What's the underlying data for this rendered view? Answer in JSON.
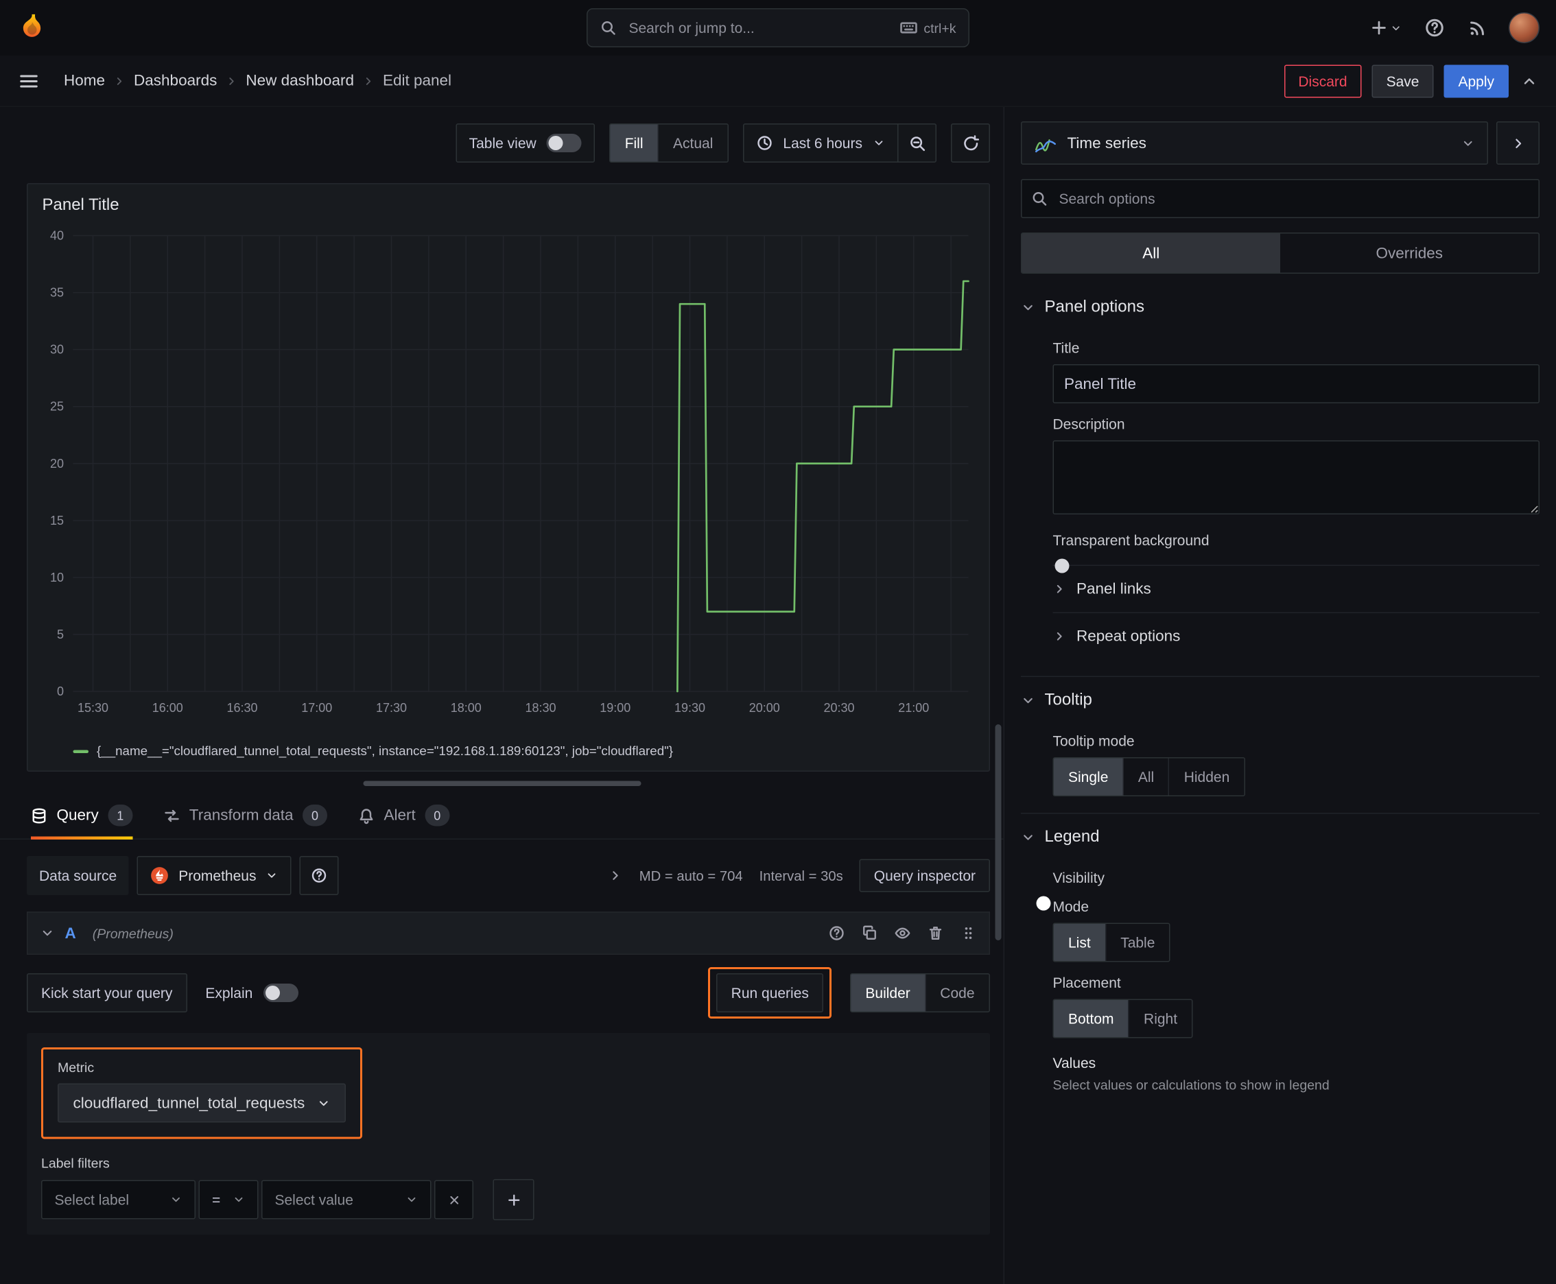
{
  "topnav": {
    "search_placeholder": "Search or jump to...",
    "shortcut": "ctrl+k"
  },
  "breadcrumb": {
    "items": [
      "Home",
      "Dashboards",
      "New dashboard",
      "Edit panel"
    ]
  },
  "actions": {
    "discard": "Discard",
    "save": "Save",
    "apply": "Apply"
  },
  "toolbar": {
    "table_view": "Table view",
    "fill": "Fill",
    "actual": "Actual",
    "time_range": "Last 6 hours"
  },
  "panel": {
    "title": "Panel Title"
  },
  "chart_data": {
    "type": "line",
    "step": true,
    "title": "Panel Title",
    "x_ticks": [
      "15:30",
      "16:00",
      "16:30",
      "17:00",
      "17:30",
      "18:00",
      "18:30",
      "19:00",
      "19:30",
      "20:00",
      "20:30",
      "21:00"
    ],
    "x_domain": [
      "15:22",
      "21:22"
    ],
    "minor_grid_minutes": 15,
    "y_ticks": [
      0,
      5,
      10,
      15,
      20,
      25,
      30,
      35,
      40
    ],
    "ylim": [
      0,
      40
    ],
    "grid": true,
    "legend_position": "bottom",
    "series": [
      {
        "name": "{__name__=\"cloudflared_tunnel_total_requests\", instance=\"192.168.1.189:60123\", job=\"cloudflared\"}",
        "color": "#73bf69",
        "points": [
          [
            "19:25",
            0
          ],
          [
            "19:26",
            34
          ],
          [
            "19:36",
            34
          ],
          [
            "19:37",
            7
          ],
          [
            "20:12",
            7
          ],
          [
            "20:13",
            20
          ],
          [
            "20:35",
            20
          ],
          [
            "20:36",
            25
          ],
          [
            "20:51",
            25
          ],
          [
            "20:52",
            30
          ],
          [
            "21:19",
            30
          ],
          [
            "21:20",
            36
          ],
          [
            "21:22",
            36
          ]
        ]
      }
    ]
  },
  "tabs": {
    "query": "Query",
    "query_count": "1",
    "transform": "Transform data",
    "transform_count": "0",
    "alert": "Alert",
    "alert_count": "0"
  },
  "query": {
    "data_source_label": "Data source",
    "data_source_value": "Prometheus",
    "max_data_points": "MD = auto = 704",
    "interval": "Interval = 30s",
    "inspector": "Query inspector",
    "ref_id": "A",
    "ref_hint": "(Prometheus)",
    "kick_start": "Kick start your query",
    "explain": "Explain",
    "run_queries": "Run queries",
    "builder": "Builder",
    "code": "Code",
    "metric_label": "Metric",
    "metric_value": "cloudflared_tunnel_total_requests",
    "label_filters_label": "Label filters",
    "select_label_placeholder": "Select label",
    "operator": "=",
    "select_value_placeholder": "Select value"
  },
  "options": {
    "viz_name": "Time series",
    "search_placeholder": "Search options",
    "tab_all": "All",
    "tab_overrides": "Overrides",
    "panel_options": {
      "header": "Panel options",
      "title_label": "Title",
      "title_value": "Panel Title",
      "description_label": "Description",
      "transparent_label": "Transparent background",
      "panel_links": "Panel links",
      "repeat_options": "Repeat options"
    },
    "tooltip": {
      "header": "Tooltip",
      "mode_label": "Tooltip mode",
      "single": "Single",
      "all": "All",
      "hidden": "Hidden"
    },
    "legend": {
      "header": "Legend",
      "visibility_label": "Visibility",
      "mode_label": "Mode",
      "list": "List",
      "table": "Table",
      "placement_label": "Placement",
      "bottom": "Bottom",
      "right": "Right",
      "values_label": "Values",
      "values_hint": "Select values or calculations to show in legend"
    }
  },
  "colors": {
    "accent_blue": "#3d71d9",
    "series_green": "#73bf69",
    "highlight_orange": "#ff7324",
    "danger_red": "#f2495c"
  }
}
